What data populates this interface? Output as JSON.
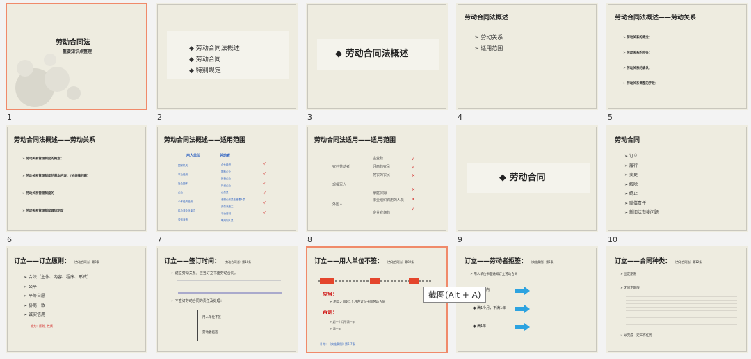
{
  "slides": [
    {
      "num": "1",
      "title": "劳动合同法",
      "subtitle": "重要知识点整理"
    },
    {
      "num": "2",
      "items": [
        "劳动合同法概述",
        "劳动合同",
        "特别规定"
      ]
    },
    {
      "num": "3",
      "title": "◆ 劳动合同法概述"
    },
    {
      "num": "4",
      "title": "劳动合同法概述",
      "items": [
        "劳动关系",
        "适用范围"
      ]
    },
    {
      "num": "5",
      "title": "劳动合同法概述——劳动关系",
      "sections": [
        "劳动关系的概念：",
        "劳动关系的特征：",
        "劳动关系的确认：",
        "劳动关系调整的手段："
      ]
    },
    {
      "num": "6",
      "title": "劳动合同法概述——劳动关系",
      "sections": [
        "劳动关系管理制度的概念：",
        "劳动关系管理制度的基本内容：（依规律判断）",
        "劳动关系管理制度的",
        "劳动关系管理制度具体制度"
      ]
    },
    {
      "num": "7",
      "title": "劳动合同法概述——适用范围",
      "labels": [
        "用人单位",
        "劳动者",
        "国家机关",
        "事业组织",
        "社会团体",
        "企业",
        "个体经济组织",
        "民办非企业单位",
        "劳务派遣",
        "合伙组织",
        "国有企业",
        "民营企业",
        "外资企业",
        "公务员",
        "参照公务员法管理人员",
        "劳务派遣工",
        "非全日制",
        "聘用制人员"
      ]
    },
    {
      "num": "8",
      "title": "劳动合同法适用——适用范围",
      "labels": [
        "企业职工",
        "农村劳动者",
        "经商的农民",
        "务农的农民",
        "现役军人",
        "家庭保姆",
        "事业组织聘用的人员",
        "外国人",
        "企业雇佣的"
      ]
    },
    {
      "num": "9",
      "title": "◆ 劳动合同"
    },
    {
      "num": "10",
      "title": "劳动合同",
      "items": [
        "订立",
        "履行",
        "变更",
        "解除",
        "终止",
        "赔偿责任",
        "新旧法衔接问题"
      ]
    },
    {
      "num": "",
      "title": "订立——订立原则：",
      "title_small": "（劳动合同法）第3条",
      "items": [
        "合法（主体、内容、程序、形式）",
        "公平",
        "平等自愿",
        "协商一致",
        "诚实信用"
      ],
      "note": "补充：原则、性质"
    },
    {
      "num": "",
      "title": "订立——签订时间：",
      "title_small": "（劳动合同法）第10条",
      "items": [
        "建立劳动关系，应当订立书面劳动合同。",
        "不签订劳动合同的责任及处理：",
        "用人单位不签",
        "劳动者拒签"
      ]
    },
    {
      "num": "",
      "title": "订立——用人单位不签：",
      "title_small": "（劳动合同法）第82条",
      "labels": [
        "应当：",
        "用工之日起1个月内订立书面劳动合同",
        "否则：",
        "超一个月不满一年",
        "满一年"
      ],
      "note": "补充：《实施条例》第6-7条"
    },
    {
      "num": "",
      "title": "订立——劳动者拒签：",
      "title_small": "（实施条例）第5条",
      "labels": [
        "用人单位书面通知订立劳动合同",
        "1个月内",
        "满1个月，不满1年",
        "满1年"
      ]
    },
    {
      "num": "",
      "title": "订立——合同种类：",
      "title_small": "（劳动合同法）第12条",
      "labels": [
        "固定期限",
        "无固定期限",
        "以完成一定工作任务"
      ]
    }
  ],
  "tooltip": "截图(Alt + A)"
}
